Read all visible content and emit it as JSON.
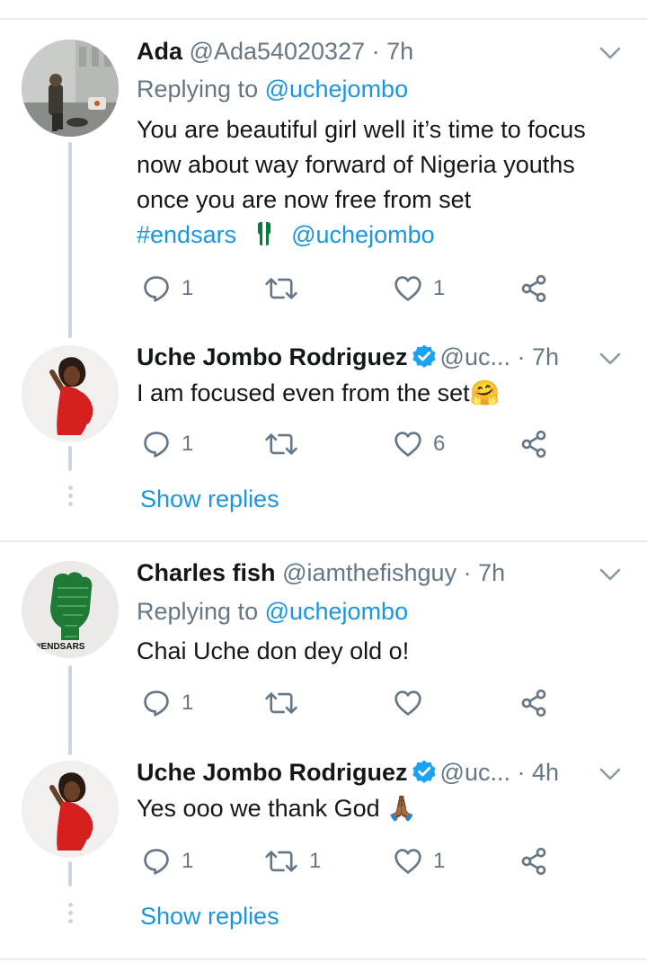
{
  "tweets": [
    {
      "name": "Ada",
      "handle": "@Ada54020327",
      "time": "· 7h",
      "replying_prefix": "Replying to ",
      "replying_to": "@uchejombo",
      "text": "You are beautiful girl well it’s time to focus now about way forward of Nigeria youths once you are now free from set",
      "hashtag": "#endsars",
      "mention": "@uchejombo",
      "replies": "1",
      "retweets": "",
      "likes": "1"
    },
    {
      "name": "Uche Jombo Rodriguez",
      "handle": "@uc...",
      "time": "· 7h",
      "text": "I am focused even from the set🤗",
      "replies": "1",
      "retweets": "",
      "likes": "6",
      "show_replies": "Show replies"
    },
    {
      "name": "Charles fish",
      "handle": "@iamthefishguy",
      "time": "· 7h",
      "replying_prefix": "Replying to ",
      "replying_to": "@uchejombo",
      "text": "Chai Uche don dey old o!",
      "replies": "1",
      "retweets": "",
      "likes": ""
    },
    {
      "name": "Uche Jombo Rodriguez",
      "handle": "@uc...",
      "time": "· 4h",
      "text": "Yes ooo we thank God 🙏🏾",
      "replies": "1",
      "retweets": "1",
      "likes": "1",
      "show_replies": "Show replies"
    }
  ],
  "avatar_texts": {
    "endsars": "#ENDSARS"
  },
  "colors": {
    "link": "#1b95e0",
    "muted": "#657786",
    "verified": "#1da1f2",
    "divider": "#e6ecf0"
  },
  "icons": [
    "reply-icon",
    "retweet-icon",
    "like-icon",
    "share-icon",
    "chevron-down-icon",
    "verified-badge-icon",
    "nigeria-fist-icon"
  ]
}
